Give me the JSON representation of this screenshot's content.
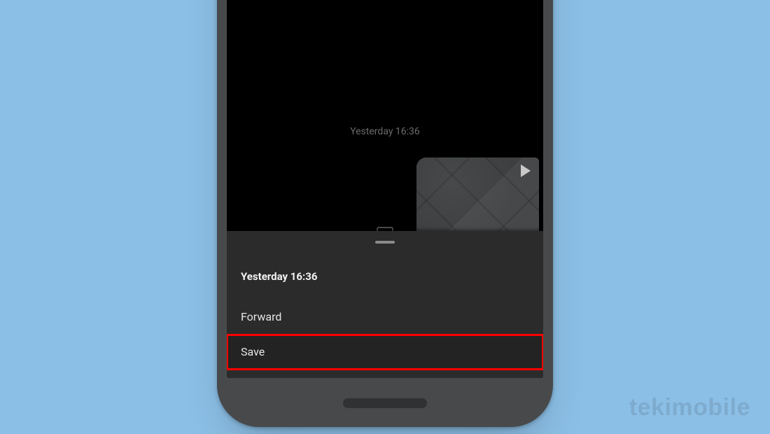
{
  "watermark": "tekimobile",
  "chat": {
    "center_timestamp": "Yesterday 16:36"
  },
  "sheet": {
    "title": "Yesterday 16:36",
    "items": [
      {
        "label": "Forward",
        "highlight": false
      },
      {
        "label": "Save",
        "highlight": true
      }
    ]
  }
}
